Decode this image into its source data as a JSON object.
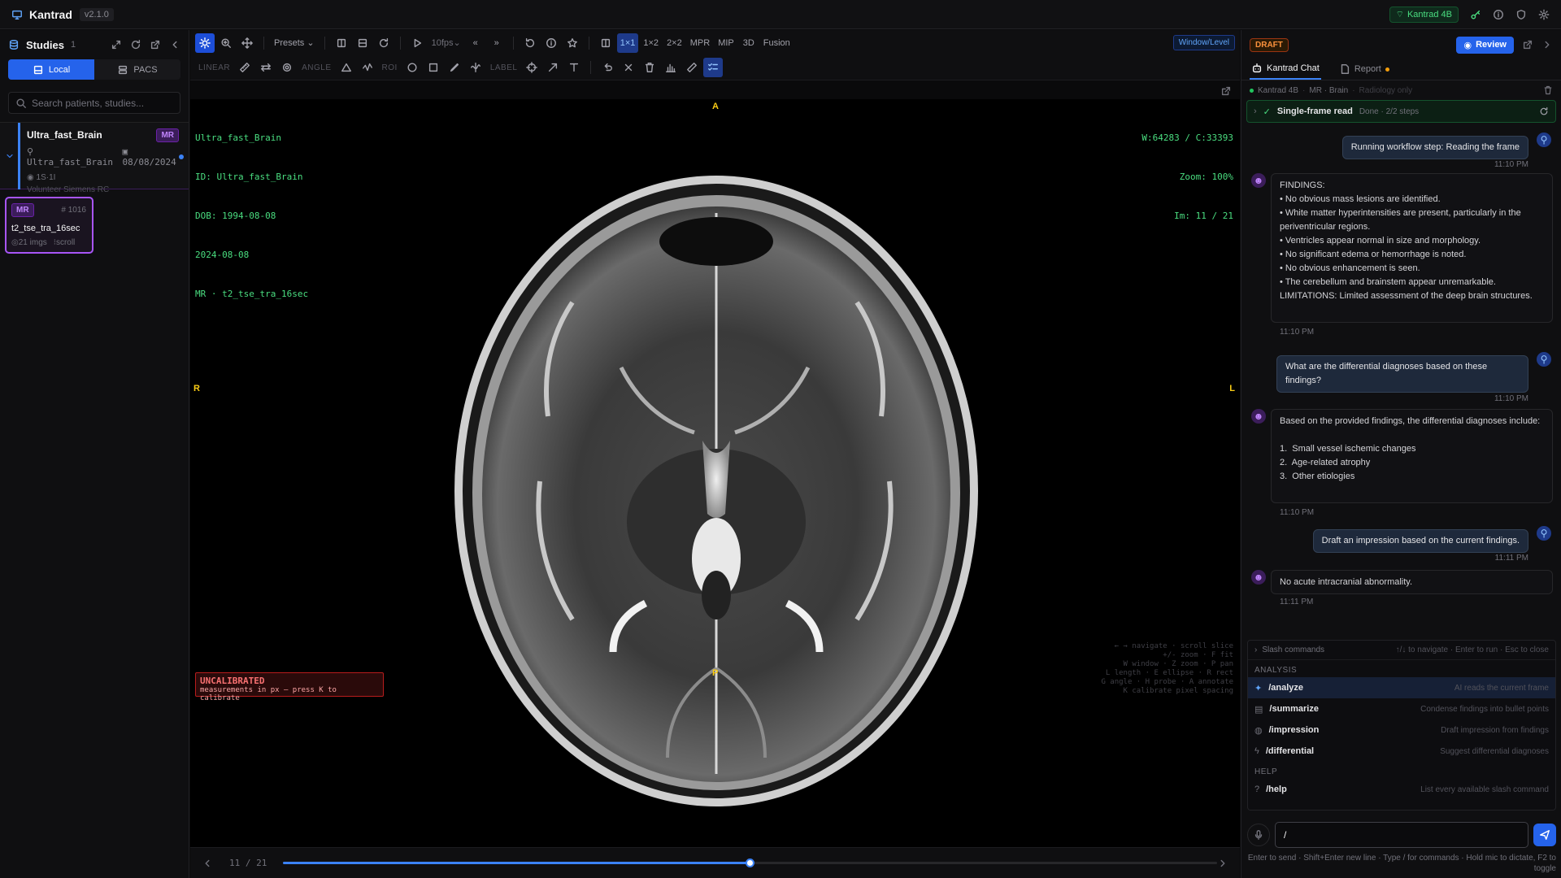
{
  "app": {
    "name": "Kantrad",
    "version": "v2.1.0",
    "model_badge": "Kantrad 4B"
  },
  "sidebar": {
    "title": "Studies",
    "count": "1",
    "tabs": [
      {
        "label": "Local"
      },
      {
        "label": "PACS"
      }
    ],
    "search_placeholder": "Search patients, studies...",
    "study": {
      "name": "Ultra_fast_Brain",
      "modality": "MR",
      "patient": "Ultra_fast_Brain",
      "date": "08/08/2024",
      "series_count": "1S·1I",
      "institution": "Volunteer Siemens RC"
    },
    "series": {
      "modality": "MR",
      "number": "# 1016",
      "name": "t2_tse_tra_16sec",
      "images": "21 imgs",
      "mode": "scroll"
    }
  },
  "toolbar": {
    "presets": "Presets",
    "fps": "10fps",
    "layouts": [
      "1×1",
      "1×2",
      "2×2",
      "MPR",
      "MIP",
      "3D",
      "Fusion"
    ],
    "window_level": "Window/Level",
    "groups": {
      "linear": "LINEAR",
      "angle": "ANGLE",
      "roi": "ROI",
      "label": "LABEL"
    }
  },
  "viewport": {
    "top_left": [
      "Ultra_fast_Brain",
      "ID: Ultra_fast_Brain",
      "DOB: 1994-08-08",
      "2024-08-08",
      "MR · t2_tse_tra_16sec"
    ],
    "top_right": [
      "W:64283 / C:33393",
      "Zoom: 100%",
      "Im: 11 / 21"
    ],
    "orient": {
      "top": "A",
      "bottom": "P",
      "left": "R",
      "right": "L"
    },
    "uncalibrated": {
      "title": "UNCALIBRATED",
      "sub": "measurements in px — press K to calibrate"
    },
    "hints": [
      "← → navigate · scroll slice",
      "+/- zoom · F fit",
      "W window · Z zoom · P pan",
      "L length · E ellipse · R rect",
      "G angle · H probe · A annotate",
      "K calibrate pixel spacing"
    ]
  },
  "slice": {
    "label": "11 / 21",
    "current": 11,
    "total": 21
  },
  "panel": {
    "draft": "DRAFT",
    "review": "Review",
    "tabs": [
      {
        "label": "Kantrad Chat"
      },
      {
        "label": "Report"
      }
    ],
    "context": {
      "model": "Kantrad 4B",
      "sep": "·",
      "scope": "MR · Brain",
      "mode": "Radiology only"
    },
    "workflow": {
      "name": "Single-frame read",
      "status": "Done · 2/2 steps"
    },
    "messages": [
      {
        "role": "user",
        "text": "Running workflow step: Reading the frame",
        "time": "11:10 PM"
      },
      {
        "role": "assistant",
        "text": "FINDINGS:\n• No obvious mass lesions are identified.\n• White matter hyperintensities are present, particularly in the periventricular regions.\n• Ventricles appear normal in size and morphology.\n• No significant edema or hemorrhage is noted.\n• No obvious enhancement is seen.\n• The cerebellum and brainstem appear unremarkable.\nLIMITATIONS: Limited assessment of the deep brain structures.",
        "time": "11:10 PM"
      },
      {
        "role": "user",
        "text": "What are the differential diagnoses based on these findings?",
        "time": "11:10 PM"
      },
      {
        "role": "assistant",
        "text": "Based on the provided findings, the differential diagnoses include:\n\n1.  Small vessel ischemic changes\n2.  Age-related atrophy\n3.  Other etiologies",
        "time": "11:10 PM"
      },
      {
        "role": "user",
        "text": "Draft an impression based on the current findings.",
        "time": "11:11 PM"
      },
      {
        "role": "assistant",
        "text": "No acute intracranial abnormality.",
        "time": "11:11 PM"
      }
    ],
    "slash": {
      "header": "Slash commands",
      "keys": "↑/↓ to navigate · Enter to run · Esc to close",
      "sections": [
        {
          "name": "ANALYSIS",
          "items": [
            {
              "cmd": "/analyze",
              "desc": "AI reads the current frame"
            },
            {
              "cmd": "/summarize",
              "desc": "Condense findings into bullet points"
            },
            {
              "cmd": "/impression",
              "desc": "Draft impression from findings"
            },
            {
              "cmd": "/differential",
              "desc": "Suggest differential diagnoses"
            }
          ]
        },
        {
          "name": "HELP",
          "items": [
            {
              "cmd": "/help",
              "desc": "List every available slash command"
            }
          ]
        }
      ]
    },
    "input_value": "/",
    "footer": "Enter to send · Shift+Enter new line · Type / for commands · Hold mic to dictate, F2 to toggle"
  }
}
